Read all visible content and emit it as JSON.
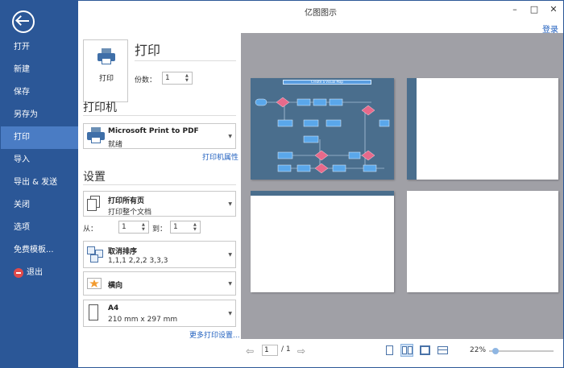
{
  "window": {
    "title": "亿图图示",
    "login": "登录"
  },
  "sidebar": {
    "items": [
      {
        "label": "打开"
      },
      {
        "label": "新建"
      },
      {
        "label": "保存"
      },
      {
        "label": "另存为"
      },
      {
        "label": "打印",
        "active": true
      },
      {
        "label": "导入"
      },
      {
        "label": "导出 & 发送"
      },
      {
        "label": "关闭"
      },
      {
        "label": "选项"
      },
      {
        "label": "免费模板..."
      },
      {
        "label": "退出"
      }
    ]
  },
  "print_panel": {
    "button_label": "打印",
    "heading": "打印",
    "copies_label": "份数：",
    "copies_value": "1",
    "printer_section": "打印机",
    "printer_name": "Microsoft Print to PDF",
    "printer_status": "就绪",
    "printer_properties_link": "打印机属性",
    "settings_section": "设置",
    "range_main": "打印所有页",
    "range_sub": "打印整个文档",
    "from_label": "从：",
    "from_value": "1",
    "to_label": "到：",
    "to_value": "1",
    "collate_main": "取消排序",
    "collate_sub": "1,1,1   2,2,2   3,3,3",
    "orientation": "横向",
    "paper_main": "A4",
    "paper_sub": "210 mm x 297 mm",
    "more_settings_link": "更多打印设置..."
  },
  "preview": {
    "diagram_title": "Create a Visual Map",
    "current_page": "1",
    "total_pages": "/ 1",
    "zoom": "22%",
    "zoom_fraction": 0.05
  },
  "colors": {
    "sidebar": "#2b5797",
    "active_item": "#4a7cc4",
    "link": "#1f5fbf",
    "preview_bg": "#a0a0a6",
    "diagram_bg": "#4a6e8d"
  }
}
